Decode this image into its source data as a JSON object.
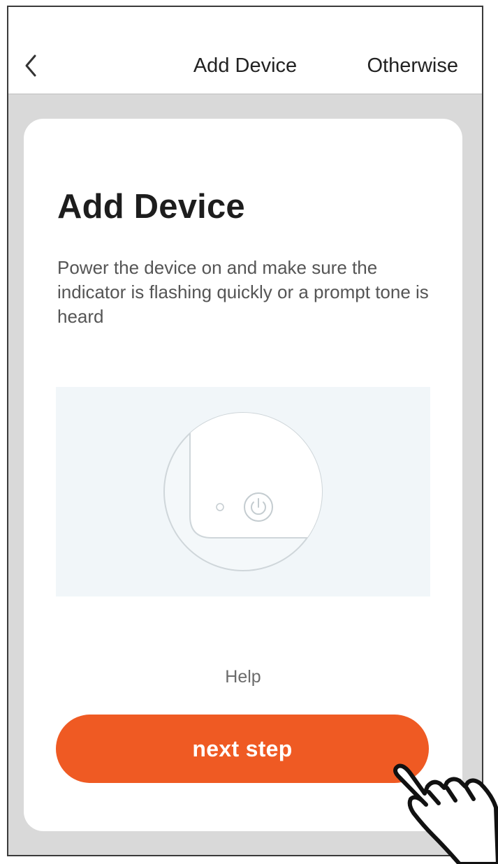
{
  "nav": {
    "back_icon": "chevron-left-icon",
    "title": "Add Device",
    "right_label": "Otherwise"
  },
  "card": {
    "title": "Add Device",
    "description": "Power the device on and make sure the indicator is flashing quickly or a prompt tone is heard",
    "illustration_icon": "power-icon",
    "help_label": "Help",
    "next_label": "next step"
  },
  "colors": {
    "accent": "#ef5a23",
    "background": "#d9d9d9",
    "card": "#ffffff"
  },
  "pointer_icon": "hand-pointer-icon"
}
